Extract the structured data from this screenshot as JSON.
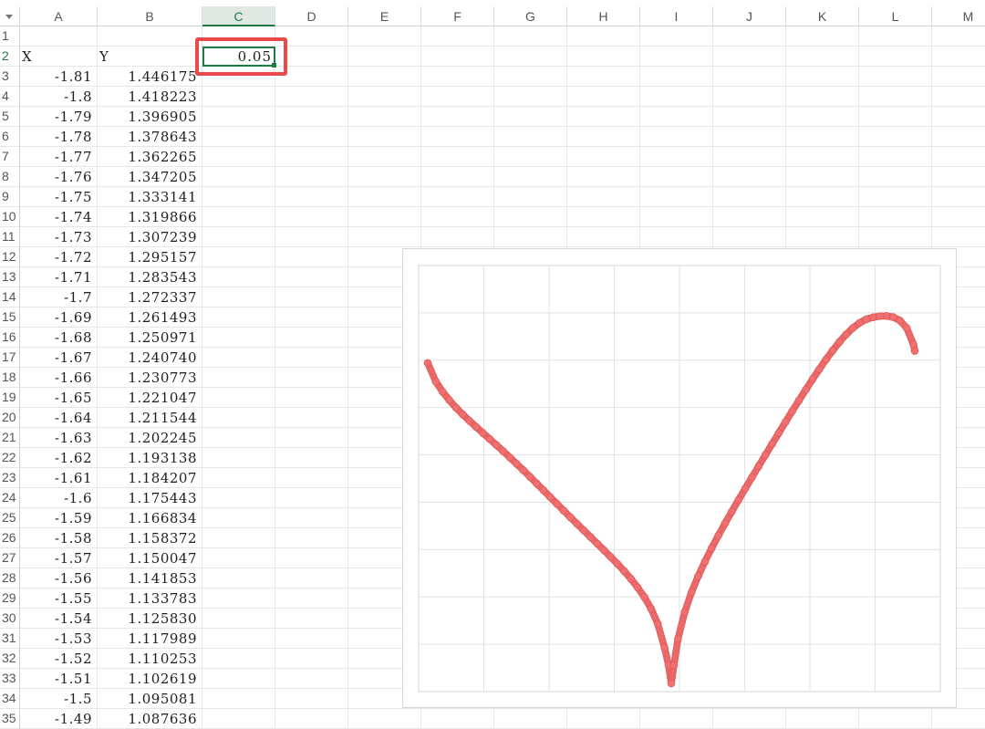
{
  "sheet": {
    "corner_icon": "select-all-triangle-icon",
    "columns": [
      "A",
      "B",
      "C",
      "D",
      "E",
      "F",
      "G",
      "H",
      "I",
      "J",
      "K",
      "L",
      "M"
    ],
    "active_column": "C",
    "active_row": "2",
    "header_x": "X",
    "header_y": "Y",
    "parameter_value": "0.05",
    "rows": [
      {
        "row": "1",
        "x": "",
        "y": ""
      },
      {
        "row": "2",
        "x": "X",
        "y": "Y"
      },
      {
        "row": "3",
        "x": "-1.81",
        "y": "1.446175"
      },
      {
        "row": "4",
        "x": "-1.8",
        "y": "1.418223"
      },
      {
        "row": "5",
        "x": "-1.79",
        "y": "1.396905"
      },
      {
        "row": "6",
        "x": "-1.78",
        "y": "1.378643"
      },
      {
        "row": "7",
        "x": "-1.77",
        "y": "1.362265"
      },
      {
        "row": "8",
        "x": "-1.76",
        "y": "1.347205"
      },
      {
        "row": "9",
        "x": "-1.75",
        "y": "1.333141"
      },
      {
        "row": "10",
        "x": "-1.74",
        "y": "1.319866"
      },
      {
        "row": "11",
        "x": "-1.73",
        "y": "1.307239"
      },
      {
        "row": "12",
        "x": "-1.72",
        "y": "1.295157"
      },
      {
        "row": "13",
        "x": "-1.71",
        "y": "1.283543"
      },
      {
        "row": "14",
        "x": "-1.7",
        "y": "1.272337"
      },
      {
        "row": "15",
        "x": "-1.69",
        "y": "1.261493"
      },
      {
        "row": "16",
        "x": "-1.68",
        "y": "1.250971"
      },
      {
        "row": "17",
        "x": "-1.67",
        "y": "1.240740"
      },
      {
        "row": "18",
        "x": "-1.66",
        "y": "1.230773"
      },
      {
        "row": "19",
        "x": "-1.65",
        "y": "1.221047"
      },
      {
        "row": "20",
        "x": "-1.64",
        "y": "1.211544"
      },
      {
        "row": "21",
        "x": "-1.63",
        "y": "1.202245"
      },
      {
        "row": "22",
        "x": "-1.62",
        "y": "1.193138"
      },
      {
        "row": "23",
        "x": "-1.61",
        "y": "1.184207"
      },
      {
        "row": "24",
        "x": "-1.6",
        "y": "1.175443"
      },
      {
        "row": "25",
        "x": "-1.59",
        "y": "1.166834"
      },
      {
        "row": "26",
        "x": "-1.58",
        "y": "1.158372"
      },
      {
        "row": "27",
        "x": "-1.57",
        "y": "1.150047"
      },
      {
        "row": "28",
        "x": "-1.56",
        "y": "1.141853"
      },
      {
        "row": "29",
        "x": "-1.55",
        "y": "1.133783"
      },
      {
        "row": "30",
        "x": "-1.54",
        "y": "1.125830"
      },
      {
        "row": "31",
        "x": "-1.53",
        "y": "1.117989"
      },
      {
        "row": "32",
        "x": "-1.52",
        "y": "1.110253"
      },
      {
        "row": "33",
        "x": "-1.51",
        "y": "1.102619"
      },
      {
        "row": "34",
        "x": "-1.5",
        "y": "1.095081"
      },
      {
        "row": "35",
        "x": "-1.49",
        "y": "1.087636"
      }
    ]
  },
  "colors": {
    "accent": "#1f7a46",
    "highlight": "#ec4a4a",
    "marker": "#f07070",
    "marker_edge": "#e05a5a",
    "gridline": "#e6e6e6"
  },
  "chart_data": {
    "type": "scatter",
    "grid": true,
    "x_range": [
      -1.81,
      1.81
    ],
    "y_range": [
      -0.55,
      1.9
    ],
    "x": [
      -1.81,
      -1.75,
      -1.7,
      -1.65,
      -1.6,
      -1.55,
      -1.5,
      -1.45,
      -1.4,
      -1.35,
      -1.3,
      -1.25,
      -1.2,
      -1.15,
      -1.1,
      -1.05,
      -1.0,
      -0.95,
      -0.9,
      -0.85,
      -0.8,
      -0.75,
      -0.7,
      -0.65,
      -0.6,
      -0.55,
      -0.5,
      -0.45,
      -0.4,
      -0.35,
      -0.3,
      -0.25,
      -0.2,
      -0.15,
      -0.1,
      -0.05,
      -0.02,
      0.0,
      0.02,
      0.05,
      0.1,
      0.15,
      0.2,
      0.25,
      0.3,
      0.35,
      0.4,
      0.45,
      0.5,
      0.55,
      0.6,
      0.65,
      0.7,
      0.75,
      0.8,
      0.85,
      0.9,
      0.95,
      1.0,
      1.05,
      1.1,
      1.15,
      1.2,
      1.25,
      1.3,
      1.35,
      1.4,
      1.45,
      1.5,
      1.55,
      1.6,
      1.65,
      1.7,
      1.75,
      1.8,
      1.81
    ],
    "y": [
      1.446,
      1.333,
      1.272,
      1.221,
      1.175,
      1.134,
      1.095,
      1.058,
      1.021,
      0.985,
      0.948,
      0.911,
      0.873,
      0.834,
      0.795,
      0.755,
      0.714,
      0.673,
      0.632,
      0.591,
      0.55,
      0.509,
      0.469,
      0.429,
      0.389,
      0.349,
      0.309,
      0.268,
      0.226,
      0.182,
      0.135,
      0.083,
      0.024,
      -0.046,
      -0.139,
      -0.283,
      -0.39,
      -0.5,
      -0.39,
      -0.23,
      -0.067,
      0.052,
      0.151,
      0.239,
      0.321,
      0.398,
      0.472,
      0.544,
      0.614,
      0.684,
      0.752,
      0.82,
      0.888,
      0.955,
      1.022,
      1.089,
      1.155,
      1.22,
      1.284,
      1.347,
      1.408,
      1.467,
      1.522,
      1.574,
      1.62,
      1.659,
      1.69,
      1.712,
      1.724,
      1.731,
      1.732,
      1.725,
      1.704,
      1.659,
      1.56,
      1.52
    ]
  }
}
